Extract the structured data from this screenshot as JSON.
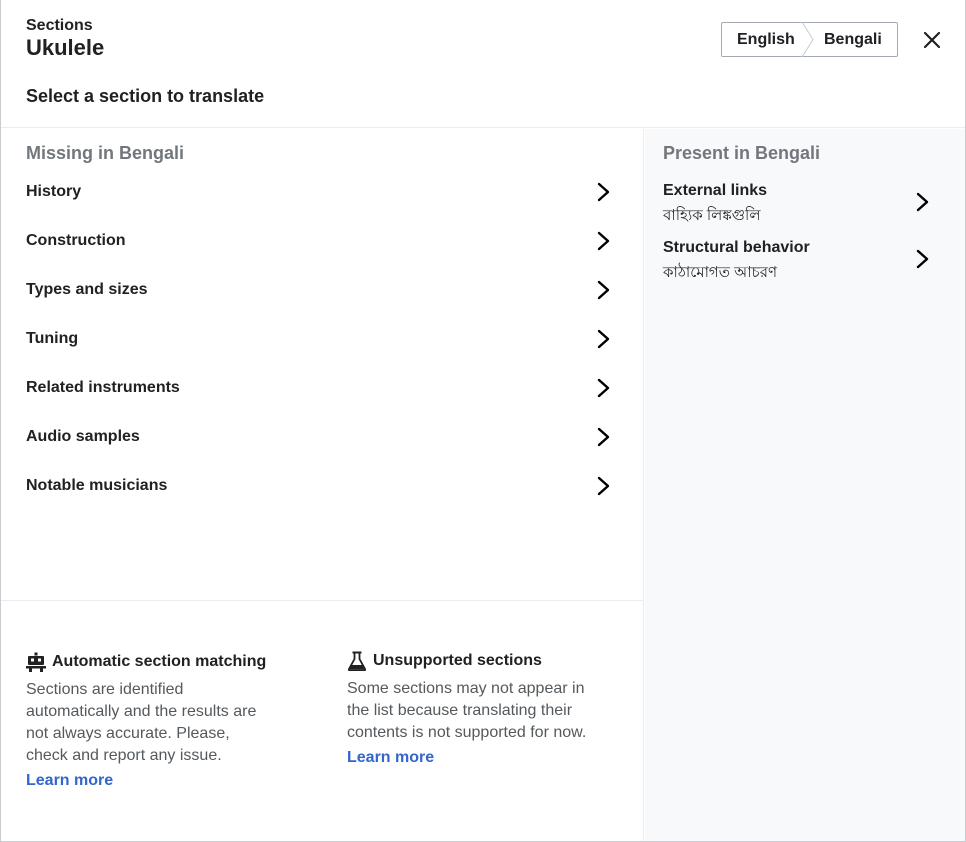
{
  "header": {
    "eyebrow": "Sections",
    "title": "Ukulele",
    "subtitle": "Select a section to translate",
    "source_language": "English",
    "target_language": "Bengali",
    "close_icon": "close-icon"
  },
  "missing": {
    "heading": "Missing in Bengali",
    "items": [
      {
        "label": "History"
      },
      {
        "label": "Construction"
      },
      {
        "label": "Types and sizes"
      },
      {
        "label": "Tuning"
      },
      {
        "label": "Related instruments"
      },
      {
        "label": "Audio samples"
      },
      {
        "label": "Notable musicians"
      }
    ]
  },
  "present": {
    "heading": "Present in Bengali",
    "items": [
      {
        "label": "External links",
        "translation": "বাহ্যিক লিঙ্কগুলি"
      },
      {
        "label": "Structural behavior",
        "translation": "কাঠামোগত আচরণ"
      }
    ]
  },
  "info": {
    "automatic": {
      "icon": "robot-icon",
      "title": "Automatic section matching",
      "text": "Sections are identified automatically and the results are not always accurate. Please, check and report any issue.",
      "link": "Learn more"
    },
    "unsupported": {
      "icon": "flask-icon",
      "title": "Unsupported sections",
      "text": "Some sections may not appear in the list because translating their contents is not supported for now.",
      "link": "Learn more"
    }
  },
  "colors": {
    "text": "#202122",
    "muted": "#72777d",
    "body": "#54595d",
    "link": "#3366cc",
    "panel": "#f8f9fa",
    "border": "#c8ccd1"
  }
}
